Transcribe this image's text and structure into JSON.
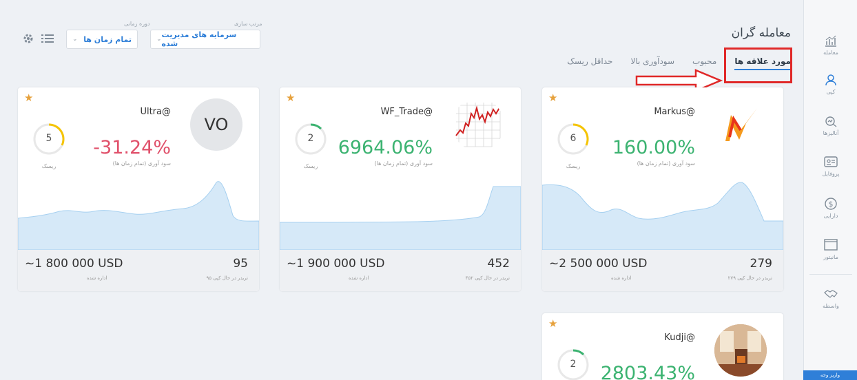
{
  "sidebar": {
    "items": [
      {
        "label": "معامله",
        "icon": "chart-bar-icon"
      },
      {
        "label": "کپی",
        "icon": "user-copy-icon"
      },
      {
        "label": "آنالیزها",
        "icon": "analytics-icon"
      },
      {
        "label": "پروفایل",
        "icon": "profile-card-icon"
      },
      {
        "label": "دارایی",
        "icon": "dollar-icon"
      },
      {
        "label": "مانیتور",
        "icon": "monitor-icon"
      },
      {
        "label": "واسطه",
        "icon": "handshake-icon"
      }
    ],
    "bottom_label": "واریز وجه"
  },
  "header": {
    "title": "معامله گران",
    "tabs": [
      {
        "label": "مورد علاقه ها",
        "active": true
      },
      {
        "label": "محبوب",
        "active": false
      },
      {
        "label": "سودآوری بالا",
        "active": false
      },
      {
        "label": "حداقل ریسک",
        "active": false
      }
    ]
  },
  "controls": {
    "sort_label": "مرتب سازی",
    "sort_value": "سرمایه های مدیریت شده",
    "period_label": "دوره زمانی",
    "period_value": "تمام زمان ها"
  },
  "cards": [
    {
      "name": "Markus@",
      "risk": "6",
      "risk_label": "ریسک",
      "profit": "160.00%",
      "profit_label": "سود آوری (تمام زمان ها)",
      "managed": "~2 500 000 USD",
      "managed_label": "اداره شده",
      "count": "279",
      "count_label": "۲۷۹ تریدر در حال کپی",
      "trend": "positive"
    },
    {
      "name": "WF_Trade@",
      "risk": "2",
      "risk_label": "ریسک",
      "profit": "6964.06%",
      "profit_label": "سود آوری (تمام زمان ها)",
      "managed": "~1 900 000 USD",
      "managed_label": "اداره شده",
      "count": "452",
      "count_label": "۴۵۲ تریدر در حال کپی",
      "trend": "positive"
    },
    {
      "name": "Ultra@",
      "avatar_text": "VO",
      "risk": "5",
      "risk_label": "ریسک",
      "profit": "-31.24%",
      "profit_label": "سود آوری (تمام زمان ها)",
      "managed": "~1 800 000 USD",
      "managed_label": "اداره شده",
      "count": "95",
      "count_label": "۹۵ تریدر در حال کپی",
      "trend": "negative"
    },
    {
      "name": "Kudji@",
      "risk": "2",
      "profit": "2803.43%",
      "trend": "positive"
    }
  ],
  "colors": {
    "accent": "#2f7fd8",
    "positive": "#3cb371",
    "negative": "#e0506a",
    "highlight": "#e02828",
    "star": "#e6a13c",
    "sparkline_fill": "#d6e9f8",
    "sparkline_stroke": "#a6d0f0"
  }
}
